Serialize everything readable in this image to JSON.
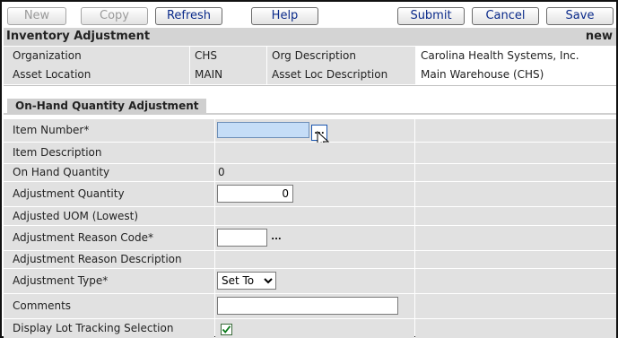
{
  "toolbar": {
    "new_label": "New",
    "copy_label": "Copy",
    "refresh_label": "Refresh",
    "help_label": "Help",
    "submit_label": "Submit",
    "cancel_label": "Cancel",
    "save_label": "Save"
  },
  "header": {
    "title": "Inventory Adjustment",
    "status": "new"
  },
  "info": {
    "organization_label": "Organization",
    "organization_value": "CHS",
    "org_description_label": "Org Description",
    "org_description_value": "Carolina Health Systems, Inc.",
    "asset_location_label": "Asset Location",
    "asset_location_value": "MAIN",
    "asset_loc_description_label": "Asset Loc Description",
    "asset_loc_description_value": "Main Warehouse (CHS)"
  },
  "section": {
    "title": "On-Hand Quantity Adjustment"
  },
  "form": {
    "item_number_label": "Item Number*",
    "item_number_value": "",
    "lookup_glyph": "...",
    "item_description_label": "Item Description",
    "on_hand_quantity_label": "On Hand Quantity",
    "on_hand_quantity_value": "0",
    "adjustment_quantity_label": "Adjustment Quantity",
    "adjustment_quantity_value": "0",
    "adjusted_uom_label": "Adjusted UOM (Lowest)",
    "adjustment_reason_code_label": "Adjustment Reason Code*",
    "adjustment_reason_code_value": "",
    "adjustment_reason_description_label": "Adjustment Reason Description",
    "adjustment_type_label": "Adjustment Type*",
    "adjustment_type_value": "Set To",
    "comments_label": "Comments",
    "comments_value": "",
    "display_lot_tracking_label": "Display Lot Tracking Selection",
    "display_lot_tracking_checked": true
  },
  "colors": {
    "label_bg": "#e1e1e1",
    "header_bg": "#d4d4d4",
    "focused_input_bg": "#c5ddf7",
    "button_text": "#0a2a8a"
  },
  "icons": {
    "lookup": "ellipsis-lookup-icon",
    "cursor": "mouse-pointer-icon",
    "checkbox": "checkmark-icon",
    "dropdown": "chevron-down-icon"
  }
}
